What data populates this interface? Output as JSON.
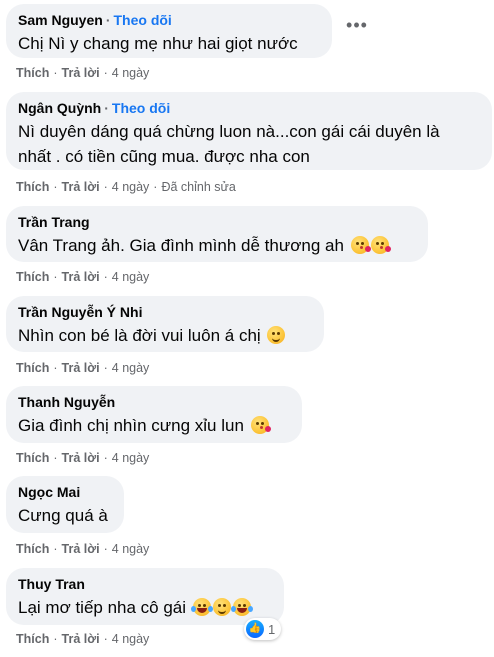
{
  "meta": {
    "follow_label": "Theo dõi",
    "like_label": "Thích",
    "reply_label": "Trả lời"
  },
  "comments": [
    {
      "author": "Sam Nguyen",
      "follow": "Theo dõi",
      "text": "Chị Nì y chang mẹ như hai giọt nước",
      "like": "Thích",
      "reply": "Trả lời",
      "time": "4 ngày"
    },
    {
      "author": "Ngân Quỳnh",
      "follow": "Theo dõi",
      "text_line1": "Nì duyên dáng quá chừng luon nà...con gái cái duyên là",
      "text_line2": "nhất . có tiền cũng mua. được nha con",
      "like": "Thích",
      "reply": "Trả lời",
      "time": "4 ngày",
      "edited": "Đã chỉnh sửa"
    },
    {
      "author": "Trần Trang",
      "text": "Vân Trang ảh. Gia đình mình dễ thương ah",
      "emojis": [
        "kiss-emoji",
        "kiss-emoji"
      ],
      "like": "Thích",
      "reply": "Trả lời",
      "time": "4 ngày"
    },
    {
      "author": "Trần Nguyễn Ý Nhi",
      "text": "Nhìn con bé là đời vui luôn á chị",
      "emojis": [
        "grin-emoji"
      ],
      "like": "Thích",
      "reply": "Trả lời",
      "time": "4 ngày"
    },
    {
      "author": "Thanh Nguyễn",
      "text": "Gia đình chị nhìn cưng xỉu lun",
      "emojis": [
        "kiss-emoji"
      ],
      "like": "Thích",
      "reply": "Trả lời",
      "time": "4 ngày"
    },
    {
      "author": "Ngọc Mai",
      "text": "Cưng quá à",
      "like": "Thích",
      "reply": "Trả lời",
      "time": "4 ngày"
    },
    {
      "author": "Thuy Tran",
      "text": "Lại mơ tiếp nha cô gái",
      "emojis": [
        "laugh-emoji",
        "grin-emoji",
        "laugh-emoji"
      ],
      "like": "Thích",
      "reply": "Trả lời",
      "time": "4 ngày",
      "reaction_count": "1"
    }
  ],
  "more_menu": "•••",
  "colors": {
    "bubble": "#f0f2f5",
    "link": "#1877f2",
    "meta": "#65676b"
  }
}
